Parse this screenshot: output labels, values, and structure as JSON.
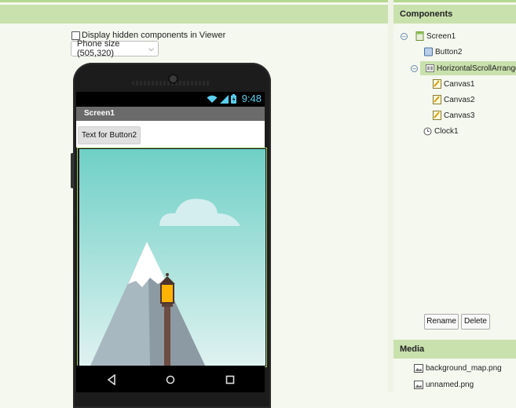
{
  "viewer": {
    "show_hidden_label": "Display hidden components in Viewer",
    "size_selected": "Phone size (505,320)"
  },
  "phone": {
    "status_time": "9:48",
    "screen_title": "Screen1",
    "button2_text": "Text for Button2"
  },
  "components": {
    "title": "Components",
    "tree": [
      {
        "label": "Screen1",
        "icon": "screen-icon"
      },
      {
        "label": "Button2",
        "icon": "button-icon"
      },
      {
        "label": "HorizontalScrollArrangem",
        "icon": "arrangement-icon"
      },
      {
        "label": "Canvas1",
        "icon": "canvas-icon"
      },
      {
        "label": "Canvas2",
        "icon": "canvas-icon"
      },
      {
        "label": "Canvas3",
        "icon": "canvas-icon"
      },
      {
        "label": "Clock1",
        "icon": "clock-icon"
      }
    ],
    "rename_label": "Rename",
    "delete_label": "Delete"
  },
  "media": {
    "title": "Media",
    "files": [
      "background_map.png",
      "unnamed.png"
    ]
  },
  "colors": {
    "header_green": "#c9e1ad",
    "sky_teal": "#6fd0c6",
    "status_blue": "#5ad0f0"
  }
}
